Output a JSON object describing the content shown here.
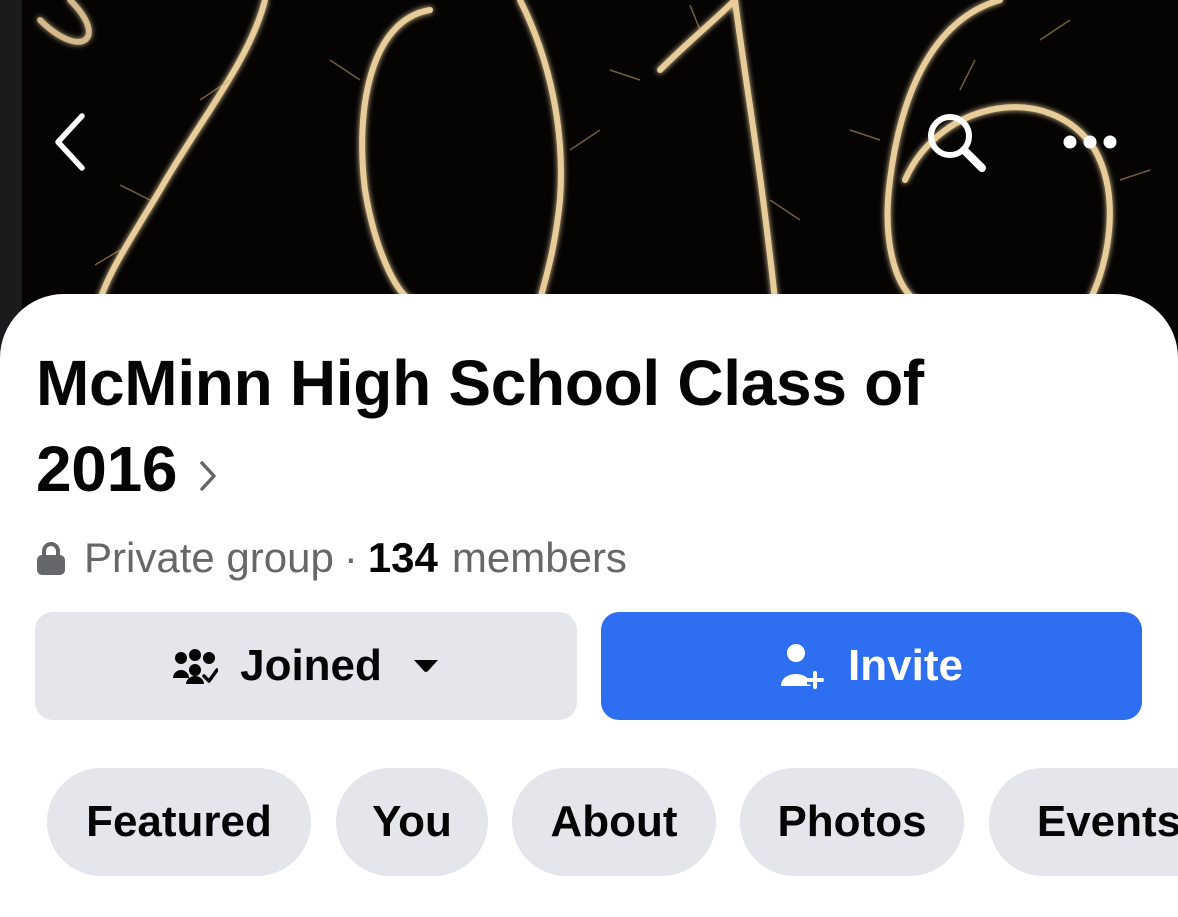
{
  "cover": {
    "year": "2016",
    "background_color": "#050403",
    "sparkle_color": "#e8cc9a"
  },
  "nav": {
    "back_icon": "chevron-left-icon",
    "search_icon": "search-icon",
    "more_icon": "more-horizontal-icon"
  },
  "group": {
    "title": "McMinn High School Class of 2016",
    "privacy": "Private group",
    "separator": "·",
    "member_count": "134",
    "member_label": "members"
  },
  "actions": {
    "joined_label": "Joined",
    "invite_label": "Invite",
    "primary_color": "#2d6ff0",
    "secondary_color": "#e4e6eb"
  },
  "tabs": [
    {
      "label": "Featured"
    },
    {
      "label": "You"
    },
    {
      "label": "About"
    },
    {
      "label": "Photos"
    },
    {
      "label": "Events"
    }
  ]
}
